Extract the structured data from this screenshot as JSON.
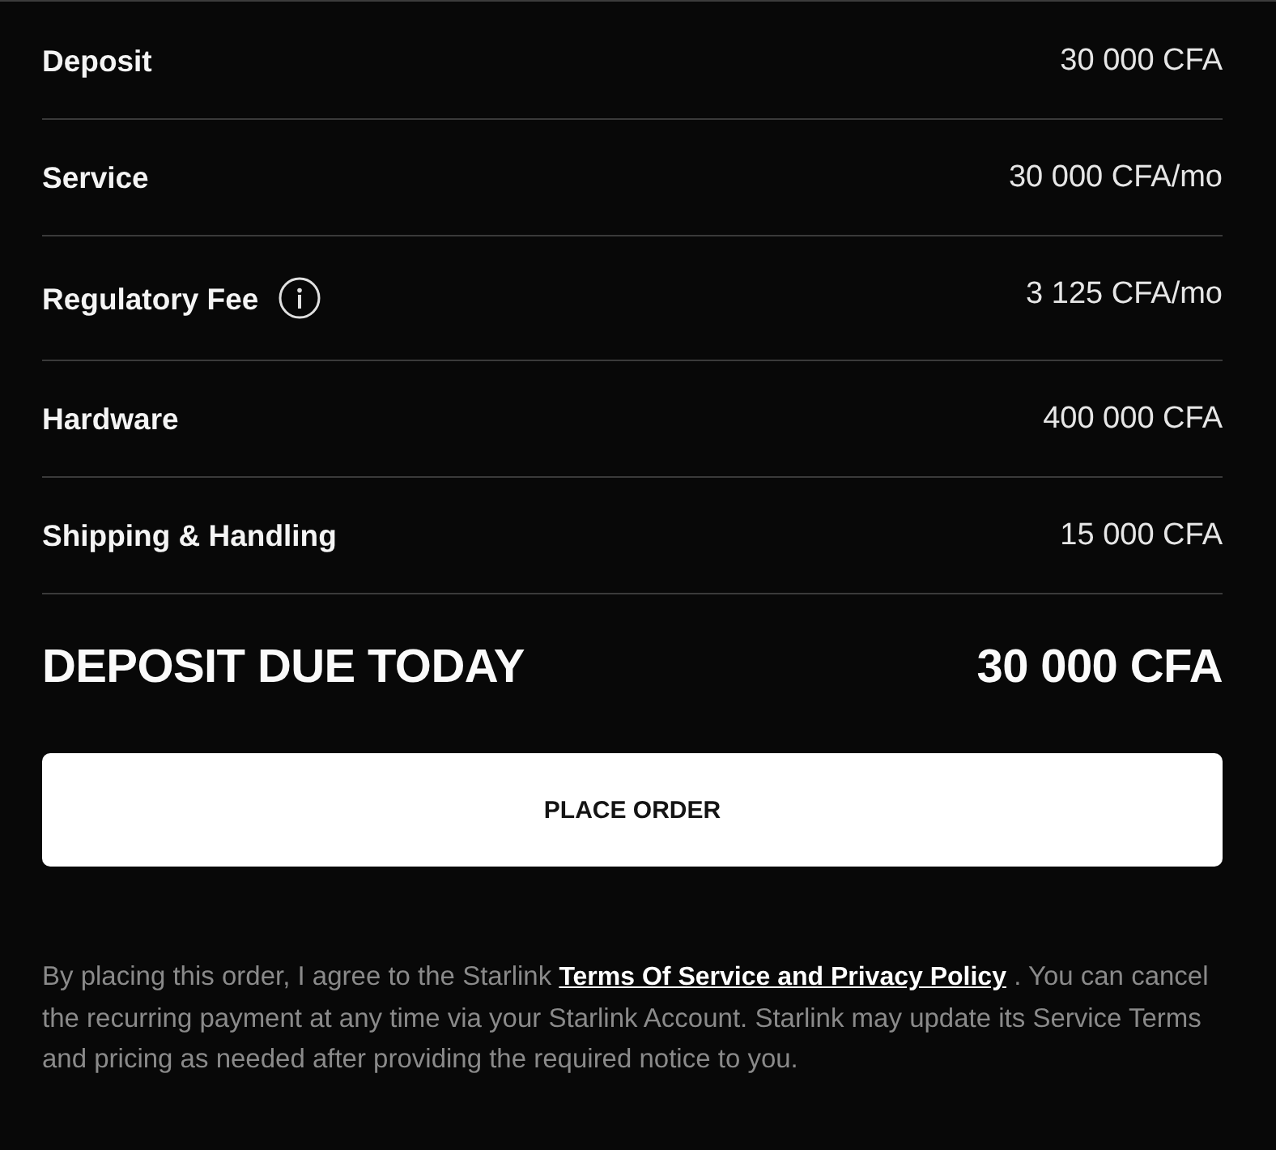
{
  "line_items": [
    {
      "label": "Deposit",
      "value": "30 000 CFA",
      "info": false
    },
    {
      "label": "Service",
      "value": "30 000 CFA/mo",
      "info": false
    },
    {
      "label": "Regulatory Fee",
      "value": "3 125 CFA/mo",
      "info": true
    },
    {
      "label": "Hardware",
      "value": "400 000 CFA",
      "info": false
    },
    {
      "label": "Shipping & Handling",
      "value": "15 000 CFA",
      "info": false
    }
  ],
  "total": {
    "label": "DEPOSIT DUE TODAY",
    "value": "30 000 CFA"
  },
  "place_order_button": {
    "label": "PLACE ORDER"
  },
  "disclaimer": {
    "text_before": "By placing this order, I agree to the Starlink",
    "link": "Terms Of Service and Privacy Policy",
    "text_after": ". You can cancel the recurring payment at any time via your Starlink Account. Starlink may update its Service Terms and pricing as needed after providing the required notice to you."
  }
}
